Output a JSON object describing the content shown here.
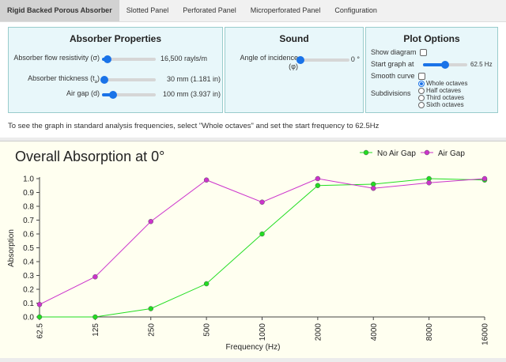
{
  "tabs": [
    {
      "label": "Rigid Backed Porous Absorber",
      "active": true
    },
    {
      "label": "Slotted Panel",
      "active": false
    },
    {
      "label": "Perforated Panel",
      "active": false
    },
    {
      "label": "Microperforated Panel",
      "active": false
    },
    {
      "label": "Configuration",
      "active": false
    }
  ],
  "absorber": {
    "title": "Absorber Properties",
    "flow": {
      "label": "Absorber flow resistivity (σ)",
      "value": "16,500 rayls/m",
      "level": 0.1
    },
    "thickness": {
      "label_main": "Absorber thickness (t",
      "label_sub": "a",
      "label_end": ")",
      "value": "30 mm  (1.181 in)",
      "level": 0.05
    },
    "gap": {
      "label": "Air gap (d)",
      "value": "100 mm  (3.937 in)",
      "level": 0.2
    }
  },
  "sound": {
    "title": "Sound",
    "angle": {
      "label_line1": "Angle of incidence",
      "label_line2": "(φ)",
      "value": "0 °",
      "level": 0.0
    }
  },
  "plot_options": {
    "title": "Plot Options",
    "show_diagram": "Show diagram",
    "start_label": "Start graph at",
    "start_value": "62.5 Hz",
    "start_level": 0.5,
    "smooth": "Smooth curve",
    "subdivisions_label": "Subdivisions",
    "subdivisions": [
      "Whole octaves",
      "Half octaves",
      "Third octaves",
      "Sixth octaves"
    ],
    "selected": 0
  },
  "note": "To see the graph in standard analysis frequencies, select \"Whole octaves\" and set the start frequency to 62.5Hz",
  "chart_data": {
    "type": "line",
    "title": "Overall Absorption at 0°",
    "xlabel": "Frequency (Hz)",
    "ylabel": "Absorption",
    "categories": [
      "62.5",
      "125",
      "250",
      "500",
      "1000",
      "2000",
      "4000",
      "8000",
      "16000"
    ],
    "ylim": [
      0,
      1
    ],
    "yticks": [
      "0.0",
      "0.1",
      "0.2",
      "0.3",
      "0.4",
      "0.5",
      "0.6",
      "0.7",
      "0.8",
      "0.9",
      "1.0"
    ],
    "legend_position": "top-right",
    "grid": false,
    "series": [
      {
        "name": "No Air Gap",
        "color": "#22dd22",
        "values": [
          0.0,
          0.0,
          0.06,
          0.24,
          0.6,
          0.95,
          0.96,
          1.0,
          0.99
        ]
      },
      {
        "name": "Air Gap",
        "color": "#cc33cc",
        "values": [
          0.09,
          0.29,
          0.69,
          0.99,
          0.83,
          1.0,
          0.93,
          0.97,
          1.0
        ]
      }
    ]
  }
}
